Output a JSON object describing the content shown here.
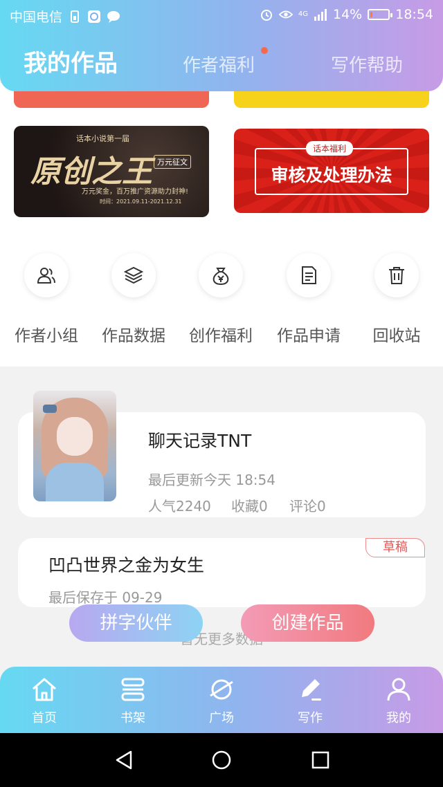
{
  "status": {
    "carrier": "中国电信",
    "net": "4G",
    "battery": "14%",
    "battery_level": 0.14,
    "time": "18:54"
  },
  "tabs": [
    {
      "label": "我的作品",
      "active": true
    },
    {
      "label": "作者福利",
      "active": false,
      "dot": true
    },
    {
      "label": "写作帮助",
      "active": false
    }
  ],
  "banners": {
    "left": {
      "top": "话本小说第一届",
      "title": "原创之王",
      "tag": "万元征文",
      "desc": "万元奖金，百万推广资源助力封神!",
      "time": "时间：2021.09.11-2021.12.31"
    },
    "right": {
      "label": "话本福利",
      "title": "审核及处理办法"
    }
  },
  "quick_actions": [
    {
      "label": "作者小组",
      "icon": "people-icon"
    },
    {
      "label": "作品数据",
      "icon": "layers-icon"
    },
    {
      "label": "创作福利",
      "icon": "money-bag-icon"
    },
    {
      "label": "作品申请",
      "icon": "document-icon"
    },
    {
      "label": "回收站",
      "icon": "trash-icon"
    }
  ],
  "works": [
    {
      "title": "聊天记录TNT",
      "updated": "最后更新今天 18:54",
      "popularity": "人气2240",
      "favorites": "收藏0",
      "comments": "评论0"
    },
    {
      "title": "凹凸世界之金为女生",
      "saved": "最后保存于 09-29",
      "badge": "草稿"
    }
  ],
  "no_more": "暂无更多数据",
  "actions": {
    "partner": "拼字伙伴",
    "create": "创建作品"
  },
  "bottom_nav": [
    {
      "label": "首页",
      "icon": "home-icon"
    },
    {
      "label": "书架",
      "icon": "bookshelf-icon"
    },
    {
      "label": "广场",
      "icon": "planet-icon"
    },
    {
      "label": "写作",
      "icon": "pen-icon",
      "active": true
    },
    {
      "label": "我的",
      "icon": "user-icon"
    }
  ]
}
